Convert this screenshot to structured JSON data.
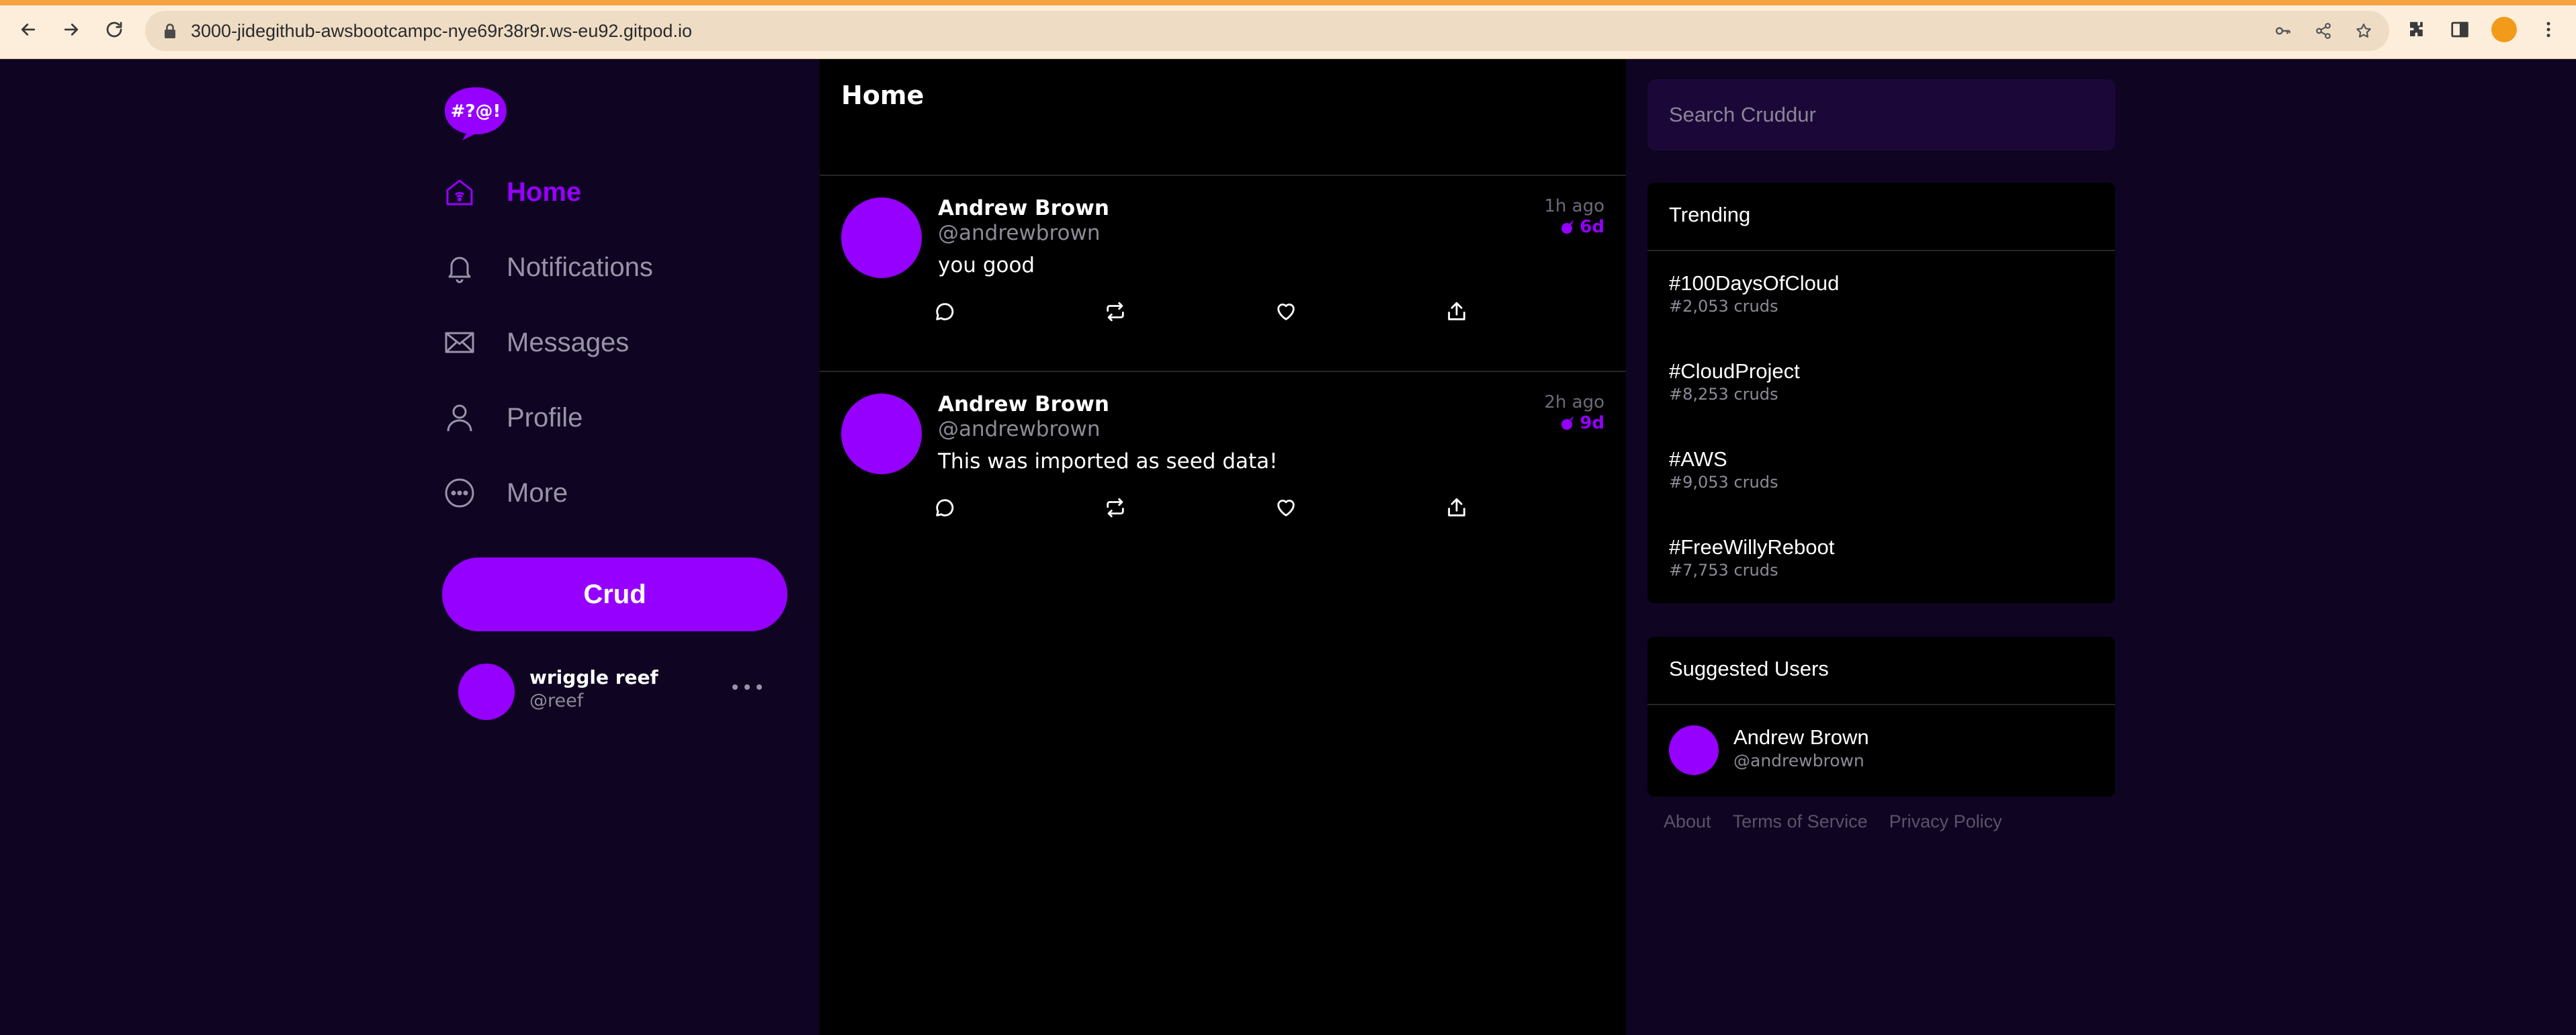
{
  "browser": {
    "url": "3000-jidegithub-awsbootcampc-nye69r38r9r.ws-eu92.gitpod.io",
    "accent_color": "#f4a340"
  },
  "brand": {
    "logo_text": "#?@!",
    "accent": "#9500ff"
  },
  "nav": {
    "items": [
      {
        "label": "Home",
        "icon": "home-icon",
        "active": true
      },
      {
        "label": "Notifications",
        "icon": "bell-icon",
        "active": false
      },
      {
        "label": "Messages",
        "icon": "mail-icon",
        "active": false
      },
      {
        "label": "Profile",
        "icon": "user-icon",
        "active": false
      },
      {
        "label": "More",
        "icon": "more-circle-icon",
        "active": false
      }
    ],
    "crud_label": "Crud"
  },
  "current_user": {
    "name": "wriggle reef",
    "handle": "@reef"
  },
  "feed": {
    "title": "Home",
    "posts": [
      {
        "name": "Andrew Brown",
        "handle": "@andrewbrown",
        "text": "you good",
        "time": "1h ago",
        "expires": "6d"
      },
      {
        "name": "Andrew Brown",
        "handle": "@andrewbrown",
        "text": "This was imported as seed data!",
        "time": "2h ago",
        "expires": "9d"
      }
    ]
  },
  "search": {
    "placeholder": "Search Cruddur"
  },
  "trending": {
    "title": "Trending",
    "items": [
      {
        "tag": "#100DaysOfCloud",
        "count": "#2,053 cruds"
      },
      {
        "tag": "#CloudProject",
        "count": "#8,253 cruds"
      },
      {
        "tag": "#AWS",
        "count": "#9,053 cruds"
      },
      {
        "tag": "#FreeWillyReboot",
        "count": "#7,753 cruds"
      }
    ]
  },
  "suggested": {
    "title": "Suggested Users",
    "users": [
      {
        "name": "Andrew Brown",
        "handle": "@andrewbrown"
      }
    ]
  },
  "footer": {
    "links": [
      "About",
      "Terms of Service",
      "Privacy Policy"
    ]
  }
}
